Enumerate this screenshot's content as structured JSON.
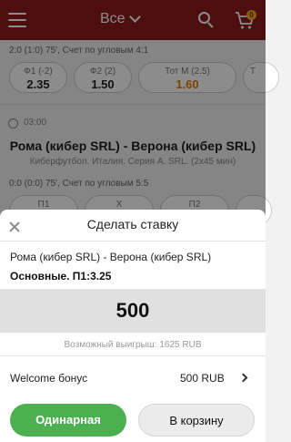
{
  "header": {
    "filter_label": "Все",
    "cart_count": "0"
  },
  "background": {
    "top_score_line": "2:0 (1:0) 75', Счет по угловым 4:1",
    "top_odds": [
      {
        "label": "Ф1 (-2)",
        "value": "2.35"
      },
      {
        "label": "Ф2 (2)",
        "value": "1.50"
      },
      {
        "label": "Тот М (2.5)",
        "value": "1.60"
      },
      {
        "label": "Т",
        "value": ""
      }
    ],
    "event_time": "03:00",
    "event_title": "Рома (кибер SRL) - Верона (кибер SRL)",
    "event_league": "Киберфутбол. Италия. Серия А. SRL. (2х45 мин)",
    "event_score_line": "0:0 (0:0) 75', Счет по угловым 5:5",
    "event_odds": [
      "П1",
      "Х",
      "П2",
      ""
    ]
  },
  "bet_slip": {
    "title": "Сделать ставку",
    "match": "Рома (кибер SRL) - Верона (кибер SRL)",
    "odds_line": "Основные. П1:3.25",
    "amount": "500",
    "payout": "Возможный выигрыш: 1625 RUB",
    "bonus_label": "Welcome бонус",
    "bonus_value": "500 RUB",
    "single_button": "Одинарная",
    "cart_button": "В корзину"
  },
  "colors": {
    "brand": "#8a1a1d",
    "primary_button": "#4caf50",
    "accent_odd": "#e07b00"
  }
}
